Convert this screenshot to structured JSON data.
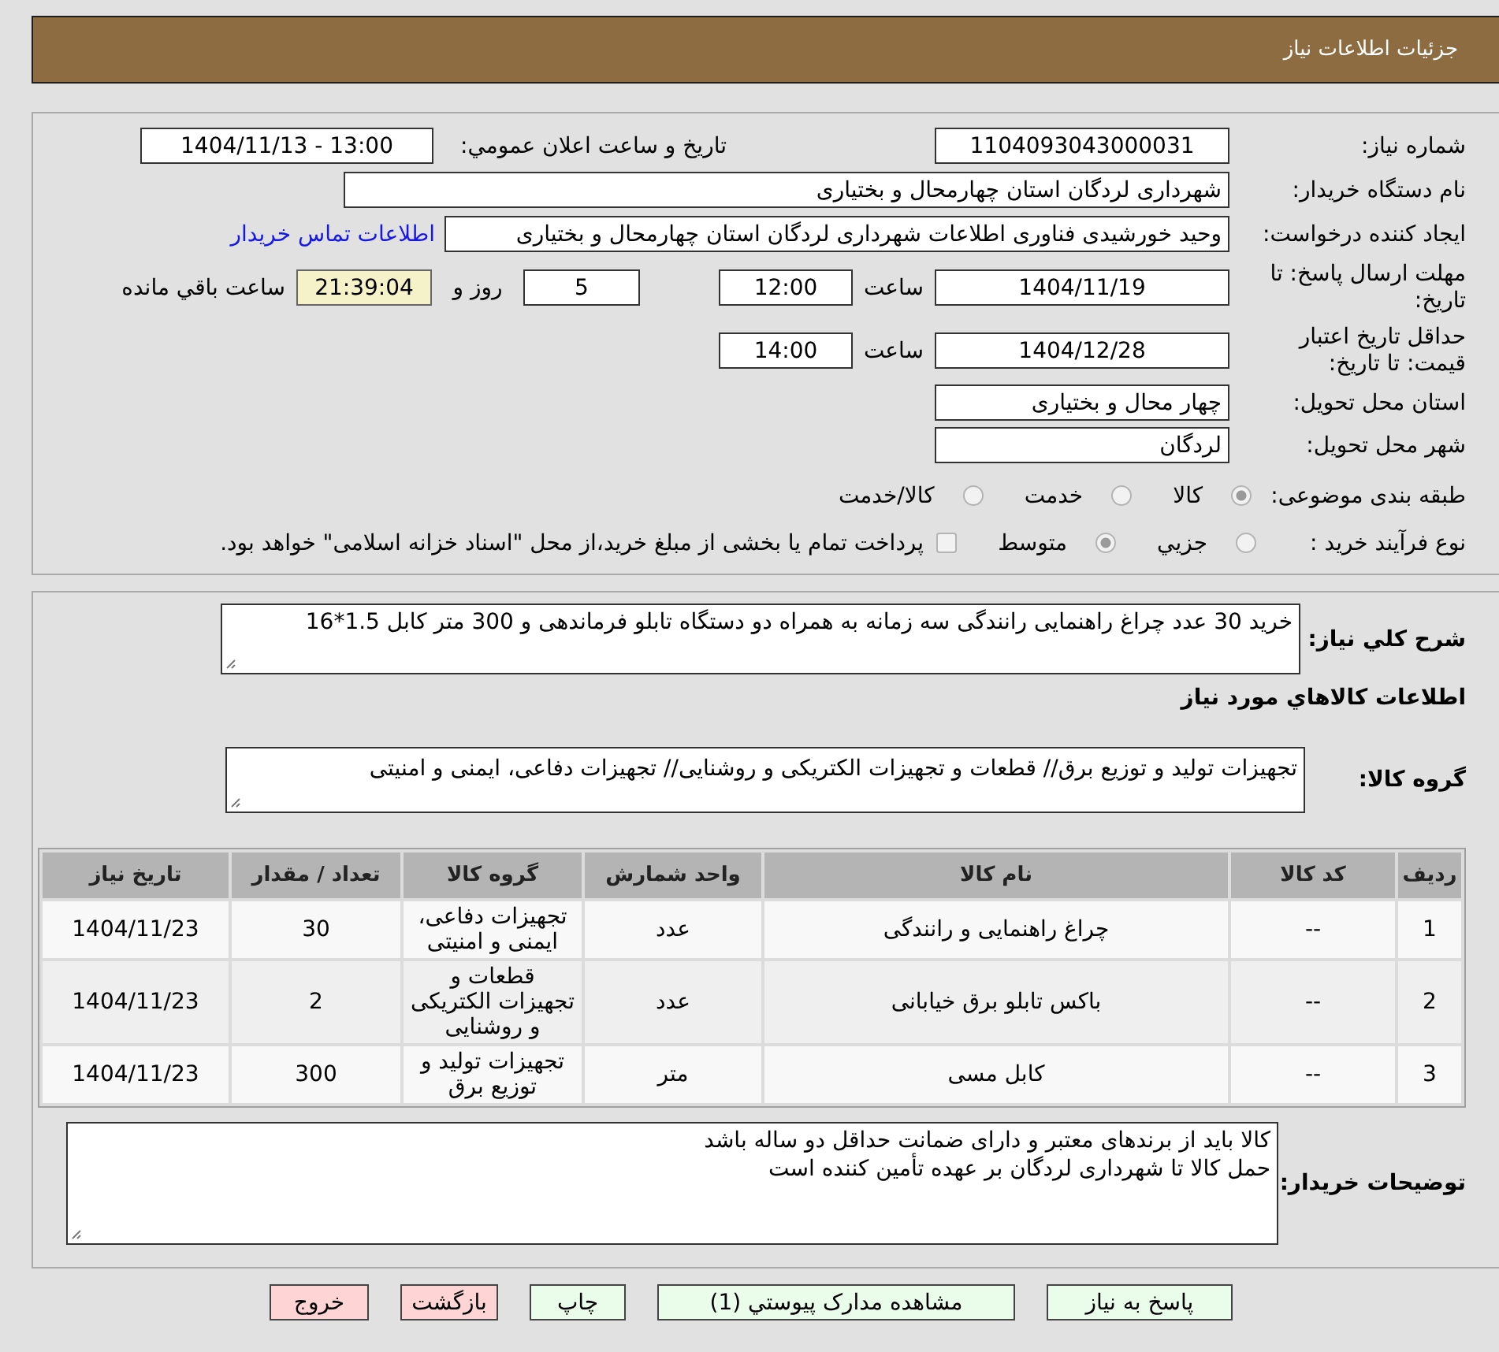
{
  "header": {
    "title": "جزئیات اطلاعات نیاز"
  },
  "details": {
    "need_number": {
      "label": "شماره نیاز:",
      "value": "1104093043000031"
    },
    "announce_datetime": {
      "label": "تاریخ و ساعت اعلان عمومي:",
      "value": "1404/11/13 - 13:00"
    },
    "buyer_org": {
      "label": "نام دستگاه خریدار:",
      "value": "شهرداری لردگان استان چهارمحال و بختیاری"
    },
    "requester": {
      "label": "ایجاد کننده درخواست:",
      "value": "وحید خورشیدی فناوری اطلاعات شهرداری لردگان استان چهارمحال و بختیاری",
      "contact_link": "اطلاعات تماس خریدار"
    },
    "response_deadline": {
      "label": "مهلت ارسال پاسخ: تا تاریخ:",
      "date": "1404/11/19",
      "time_label": "ساعت",
      "time": "12:00",
      "days": "5",
      "days_label": "روز و",
      "remaining": "21:39:04",
      "remaining_label": "ساعت باقي مانده"
    },
    "price_validity": {
      "label": "حداقل تاریخ اعتبار قیمت: تا تاریخ:",
      "date": "1404/12/28",
      "time_label": "ساعت",
      "time": "14:00"
    },
    "delivery_province": {
      "label": "استان محل تحویل:",
      "value": "چهار محال و بختیاری"
    },
    "delivery_city": {
      "label": "شهر محل تحویل:",
      "value": "لردگان"
    },
    "subject_category": {
      "label": "طبقه بندی موضوعی:",
      "options": [
        {
          "label": "کالا",
          "selected": true
        },
        {
          "label": "خدمت",
          "selected": false
        },
        {
          "label": "کالا/خدمت",
          "selected": false
        }
      ]
    },
    "purchase_process": {
      "label": "نوع فرآیند خرید :",
      "options": [
        {
          "label": "جزيي",
          "selected": false
        },
        {
          "label": "متوسط",
          "selected": true
        }
      ],
      "treasury_payment": {
        "label": "پرداخت تمام یا بخشی از مبلغ خرید،از محل \"اسناد خزانه اسلامی\" خواهد بود.",
        "checked": false
      }
    }
  },
  "summary": {
    "label": "شرح کلي نیاز:",
    "value": "خرید 30 عدد چراغ راهنمایی رانندگی سه زمانه به همراه دو دستگاه تابلو فرماندهی و 300 متر کابل 1.5*16"
  },
  "goods": {
    "heading": "اطلاعات کالاهاي مورد نیاز",
    "group_label": "گروه کالا:",
    "group_value": "تجهیزات تولید و توزیع برق// قطعات و تجهیزات الکتریکی و روشنایی// تجهیزات دفاعی، ایمنی و امنیتی"
  },
  "table": {
    "columns": [
      "ردیف",
      "کد کالا",
      "نام کالا",
      "واحد شمارش",
      "گروه کالا",
      "تعداد / مقدار",
      "تاریخ نیاز"
    ],
    "rows": [
      [
        "1",
        "--",
        "چراغ راهنمایی و رانندگی",
        "عدد",
        "تجهیزات دفاعی، ایمنی و امنیتی",
        "30",
        "1404/11/23"
      ],
      [
        "2",
        "--",
        "باکس تابلو برق خیابانی",
        "عدد",
        "قطعات و تجهیزات الکتریکی و روشنایی",
        "2",
        "1404/11/23"
      ],
      [
        "3",
        "--",
        "کابل مسی",
        "متر",
        "تجهیزات تولید و توزیع برق",
        "300",
        "1404/11/23"
      ]
    ]
  },
  "buyer_notes": {
    "label": "توضیحات خریدار:",
    "lines": [
      "کالا باید از برندهای معتبر و دارای ضمانت حداقل دو ساله باشد",
      "حمل کالا تا شهرداری لردگان بر عهده تأمین کننده است"
    ]
  },
  "buttons": [
    {
      "label": "پاسخ به نیاز",
      "kind": "action"
    },
    {
      "label": "مشاهده مدارک پیوستي (1)",
      "kind": "action"
    },
    {
      "label": "چاپ",
      "kind": "action"
    },
    {
      "label": "بازگشت",
      "kind": "exit"
    },
    {
      "label": "خروج",
      "kind": "exit"
    }
  ]
}
